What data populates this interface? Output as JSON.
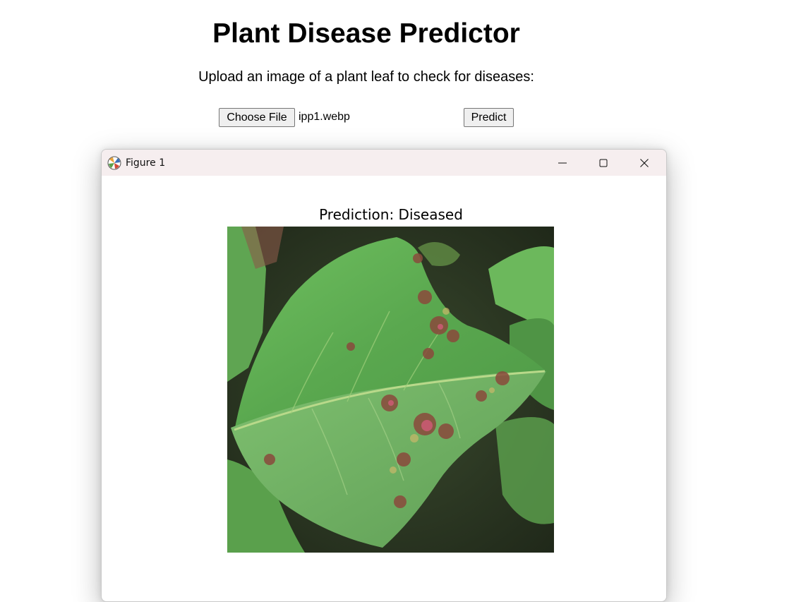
{
  "page": {
    "title": "Plant Disease Predictor",
    "subtitle": "Upload an image of a plant leaf to check for diseases:"
  },
  "upload": {
    "choose_label": "Choose File",
    "file_name": "ipp1.webp",
    "predict_label": "Predict"
  },
  "figure_window": {
    "title": "Figure 1",
    "app_icon": "matplotlib-icon",
    "controls": [
      "minimize-icon",
      "maximize-icon",
      "close-icon"
    ],
    "plot_title": "Prediction: Diseased",
    "image_description_icon": "leaf-image"
  },
  "colors": {
    "titlebar_bg": "#f6eeef",
    "button_bg": "#efefef",
    "leaf_green": "#5fae58",
    "lesion_brown": "#8a4a3c"
  }
}
